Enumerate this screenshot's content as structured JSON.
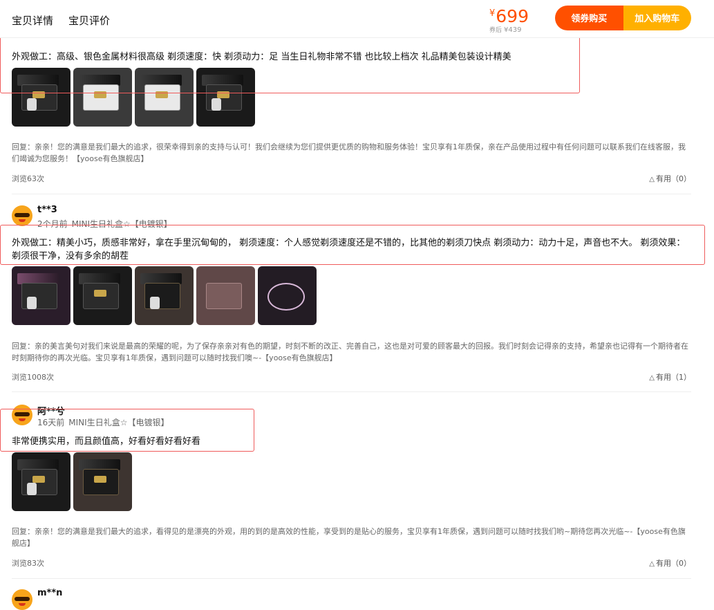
{
  "header": {
    "tab_details": "宝贝详情",
    "tab_reviews": "宝贝评价",
    "price_currency": "¥",
    "price": "699",
    "sub_label": "券后",
    "sub_price": "¥439",
    "coupon_button": "领券购买",
    "cart_button": "加入购物车"
  },
  "colors": {
    "accent_orange": "#ff5000",
    "accent_yellow": "#ffb000",
    "highlight_red": "#ef5b5b"
  },
  "reviews": [
    {
      "text": "外观做工：高级、银色金属材料很高级 剃须速度：快 剃须动力：足 当生日礼物非常不错 也比较上档次 礼品精美包装设计精美",
      "reply": "回复：亲亲！您的满意是我们最大的追求，很荣幸得到亲的支持与认可！我们会继续为您们提供更优质的购物和服务体验！宝贝享有1年质保，亲在产品使用过程中有任何问题可以联系我们在线客服，我们竭诚为您服务！【yoose有色旗舰店】",
      "views": "浏览63次",
      "useful": "有用（0）",
      "image_count": 4
    },
    {
      "user": "t**3",
      "time": "2个月前",
      "variant": "MINI生日礼盒☆【电镀银】",
      "text": "外观做工：精美小巧，质感非常好，拿在手里沉甸甸的， 剃须速度：个人感觉剃须速度还是不错的，比其他的剃须刀快点 剃须动力：动力十足，声音也不大。 剃须效果：剃须很干净，没有多余的胡茬",
      "reply": "回复：亲的美言美句对我们来说是最高的荣耀的呢，为了保存亲亲对有色的期望，时刻不断的改正、完善自己，这也是对可爱的顾客最大的回报。我们时刻会记得亲的支持，希望亲也记得有一个期待者在时刻期待你的再次光临。宝贝享有1年质保，遇到问题可以随时找我们噢~-【yoose有色旗舰店】",
      "views": "浏览1008次",
      "useful": "有用（1）",
      "image_count": 5
    },
    {
      "user": "阿**兮",
      "time": "16天前",
      "variant": "MINI生日礼盒☆【电镀银】",
      "text": "非常便携实用，而且颜值高，好看好看好看好看",
      "reply": "回复：亲亲！您的满意是我们最大的追求，看得见的是漂亮的外观，用的到的是高效的性能，享受到的是贴心的服务，宝贝享有1年质保，遇到问题可以随时找我们哟~期待您再次光临~-【yoose有色旗舰店】",
      "views": "浏览83次",
      "useful": "有用（0）",
      "image_count": 2
    },
    {
      "user": "m**n"
    }
  ]
}
